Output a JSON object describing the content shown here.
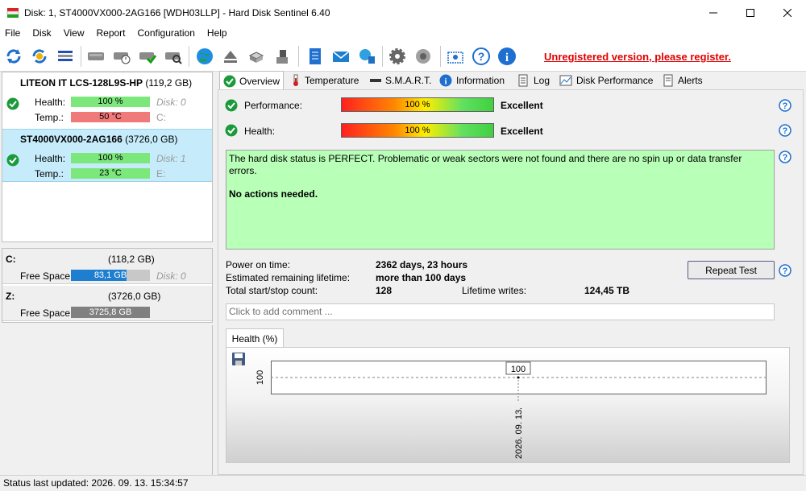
{
  "window": {
    "title": "Disk: 1, ST4000VX000-2AG166 [WDH03LLP]  -  Hard Disk Sentinel 6.40"
  },
  "menu": [
    "File",
    "Disk",
    "View",
    "Report",
    "Configuration",
    "Help"
  ],
  "toolbar": {
    "unregistered_text": "Unregistered version, please register.",
    "icons": [
      "refresh-icon",
      "refresh-all-icon",
      "disk-details-icon",
      "disk-icon",
      "disk-schedule-icon",
      "disk-check-icon",
      "disk-search-icon",
      "globe-icon",
      "eject-icon",
      "printer-icon",
      "usb-icon",
      "report-icon",
      "mail-icon",
      "network-icon",
      "settings-icon",
      "sound-icon",
      "screenshot-icon",
      "help-icon",
      "info-icon"
    ]
  },
  "disks": [
    {
      "name_bold": "LITEON IT LCS-128L9S-HP",
      "size": "(119,2 GB)",
      "health_label": "Health:",
      "health": "100 %",
      "disk_label": "Disk: 0",
      "temp_label": "Temp.:",
      "temp": "50 °C",
      "drive": "C:"
    },
    {
      "name_bold": "ST4000VX000-2AG166",
      "size": "(3726,0 GB)",
      "health_label": "Health:",
      "health": "100 %",
      "disk_label": "Disk: 1",
      "temp_label": "Temp.:",
      "temp": "23 °C",
      "drive": "E:"
    }
  ],
  "volumes": [
    {
      "name": "C:",
      "size": "(118,2 GB)",
      "free_label": "Free Space",
      "free": "83,1 GB",
      "disk_label": "Disk: 0",
      "color": "#1e7fd0",
      "free_fraction": 0.7
    },
    {
      "name": "Z:",
      "size": "(3726,0 GB)",
      "free_label": "Free Space",
      "free": "3725,8 GB",
      "disk_label": "",
      "color": "#808080",
      "free_fraction": 1.0
    }
  ],
  "tabs": [
    "Overview",
    "Temperature",
    "S.M.A.R.T.",
    "Information",
    "Log",
    "Disk Performance",
    "Alerts"
  ],
  "overview": {
    "performance_label": "Performance:",
    "performance_value": "100 %",
    "performance_rating": "Excellent",
    "health_label": "Health:",
    "health_value": "100 %",
    "health_rating": "Excellent",
    "message_line": "The hard disk status is PERFECT. Problematic or weak sectors were not found and there are no spin up or data transfer errors.",
    "message_action": "No actions needed.",
    "power_on_label": "Power on time:",
    "power_on_value": "2362 days, 23 hours",
    "lifetime_label": "Estimated remaining lifetime:",
    "lifetime_value": "more than 100 days",
    "startstop_label": "Total start/stop count:",
    "startstop_value": "128",
    "writes_label": "Lifetime writes:",
    "writes_value": "124,45 TB",
    "repeat_button": "Repeat Test",
    "comment_placeholder": "Click to add comment ..."
  },
  "chart_tab": "Health (%)",
  "chart_data": {
    "type": "line",
    "x": [
      "2026. 09. 13."
    ],
    "series": [
      {
        "values": [
          100
        ]
      }
    ],
    "ylabel": "",
    "ytick": "100",
    "point_label": "100"
  },
  "status": "Status last updated: 2026. 09. 13. 15:34:57"
}
